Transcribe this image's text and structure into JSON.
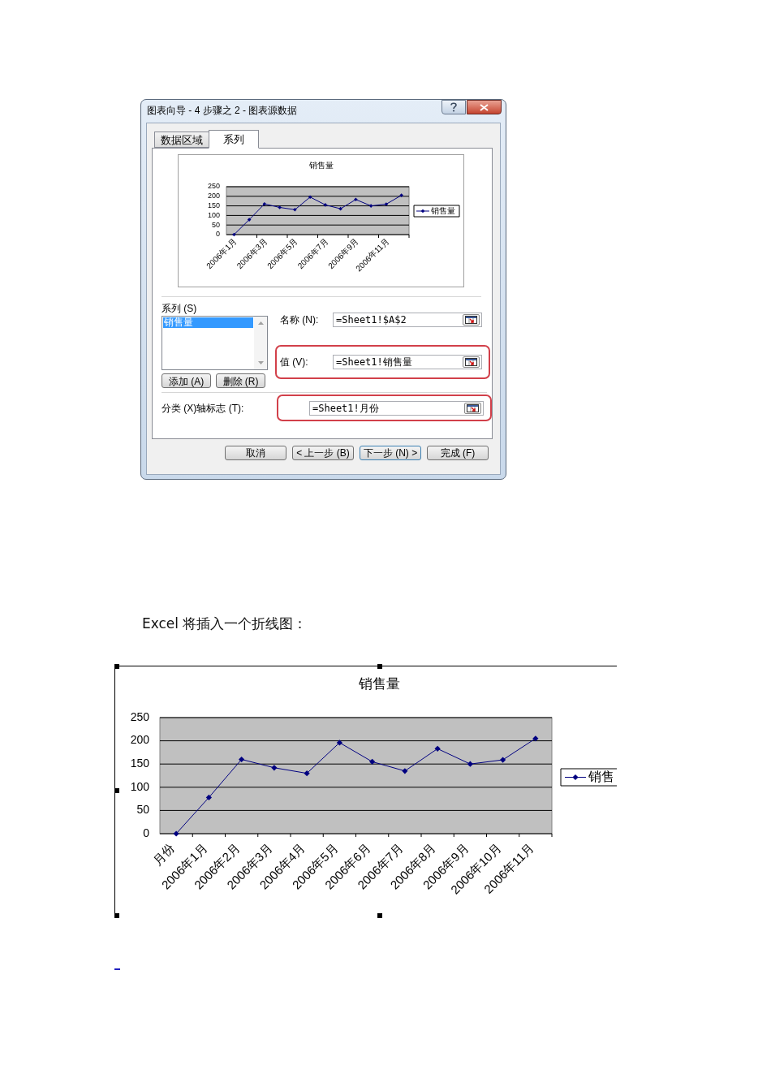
{
  "dialog": {
    "title": "图表向导 - 4 步骤之 2 - 图表源数据",
    "tabs": [
      {
        "label": "数据区域",
        "selected": false
      },
      {
        "label": "系列",
        "selected": true
      }
    ],
    "preview": {
      "chart_data": {
        "type": "line",
        "title": "销售量",
        "categories": [
          "2006年1月",
          null,
          "2006年3月",
          null,
          "2006年5月",
          null,
          "2006年7月",
          null,
          "2006年9月",
          null,
          "2006年11月",
          null
        ],
        "ylim": [
          0,
          250
        ],
        "yticks": [
          0,
          50,
          100,
          150,
          200,
          250
        ],
        "grid": true,
        "series": [
          {
            "name": "销售量",
            "color": "#000080",
            "marker": "diamond",
            "values": [
              0,
              78,
              160,
              142,
              130,
              196,
              155,
              135,
              183,
              150,
              159,
              205
            ]
          }
        ]
      }
    },
    "series_list": {
      "label": "系列 (S)",
      "items": [
        {
          "label": "销售量",
          "selected": true
        }
      ]
    },
    "list_buttons": [
      "添加 (A)",
      "删除 (R)"
    ],
    "series_fields": [
      {
        "label": "名称 (N):",
        "value": "=Sheet1!$A$2",
        "highlighted": false
      },
      {
        "label": "值 (V):",
        "value": "=Sheet1!销售量",
        "highlighted": true
      }
    ],
    "category_field": {
      "label": "分类 (X)轴标志 (T):",
      "value": "=Sheet1!月份",
      "highlighted": true
    },
    "buttons": [
      {
        "label": "取消",
        "default": false
      },
      {
        "label": "< 上一步 (B)",
        "default": false
      },
      {
        "label": "下一步 (N) >",
        "default": true
      },
      {
        "label": "完成 (F)",
        "default": false
      }
    ]
  },
  "paragraph": "Excel 将插入一个折线图：",
  "chart": {
    "selected": true,
    "chart_data": {
      "type": "line",
      "title": "销售量",
      "categories": [
        "月份",
        "2006年1月",
        "2006年2月",
        "2006年3月",
        "2006年4月",
        "2006年5月",
        "2006年6月",
        "2006年7月",
        "2006年8月",
        "2006年9月",
        "2006年10月",
        "2006年11月"
      ],
      "ylim": [
        0,
        250
      ],
      "yticks": [
        0,
        50,
        100,
        150,
        200,
        250
      ],
      "grid": true,
      "series": [
        {
          "name": "销售",
          "color": "#000080",
          "marker": "diamond",
          "values": [
            0,
            78,
            160,
            142,
            130,
            196,
            155,
            135,
            183,
            150,
            159,
            205
          ]
        }
      ]
    }
  }
}
